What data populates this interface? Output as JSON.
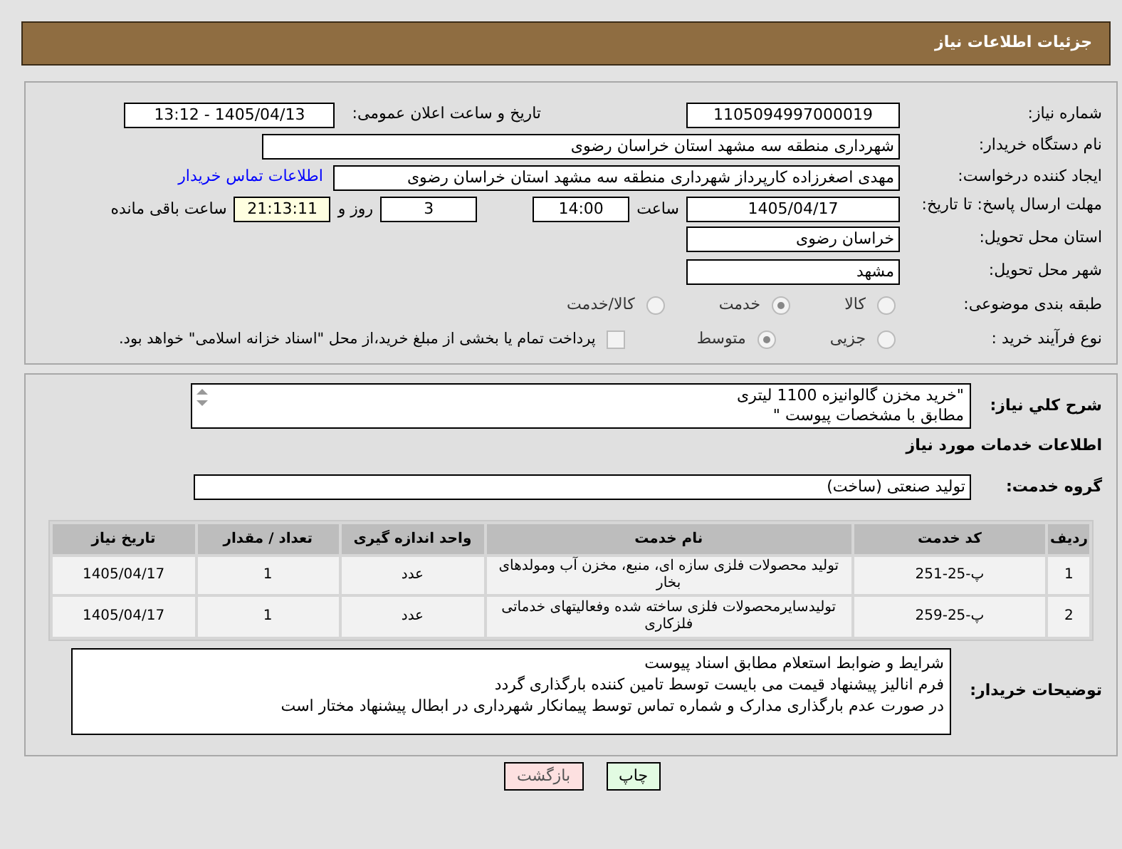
{
  "header": {
    "title": "جزئیات اطلاعات نیاز"
  },
  "need_number": {
    "label": "شماره نیاز:",
    "value": "1105094997000019"
  },
  "announce": {
    "label": "تاریخ و ساعت اعلان عمومی:",
    "value": "1405/04/13 - 13:12"
  },
  "buyer": {
    "label": "نام دستگاه خریدار:",
    "value": "شهرداری منطقه سه مشهد استان خراسان رضوی"
  },
  "creator": {
    "label": "ایجاد کننده درخواست:",
    "value": "مهدی اصغرزاده کارپرداز شهرداری منطقه سه مشهد استان خراسان رضوی",
    "link": "اطلاعات تماس خریدار"
  },
  "deadline": {
    "label": "مهلت ارسال پاسخ: تا تاریخ:",
    "date": "1405/04/17",
    "time_label": "ساعت",
    "time": "14:00",
    "days": "3",
    "days_label": "روز و",
    "remaining": "21:13:11",
    "remaining_label": "ساعت باقی مانده"
  },
  "province": {
    "label": "استان محل تحویل:",
    "value": "خراسان رضوی"
  },
  "city": {
    "label": "شهر محل تحویل:",
    "value": "مشهد"
  },
  "category": {
    "label": "طبقه بندی موضوعی:",
    "options": [
      {
        "label": "کالا",
        "selected": false
      },
      {
        "label": "خدمت",
        "selected": true
      },
      {
        "label": "کالا/خدمت",
        "selected": false
      }
    ]
  },
  "process": {
    "label": "نوع فرآیند خرید :",
    "options": [
      {
        "label": "جزیی",
        "selected": false
      },
      {
        "label": "متوسط",
        "selected": true
      }
    ],
    "payment": {
      "checked": false,
      "text": "پرداخت تمام یا بخشی از مبلغ خرید،از محل \"اسناد خزانه اسلامی\" خواهد بود."
    }
  },
  "description": {
    "label": "شرح كلي نياز:",
    "lines": [
      "\"خرید مخزن گالوانیزه 1100 لیتری",
      "مطابق با مشخصات پیوست \""
    ]
  },
  "services_title": "اطلاعات خدمات مورد نیاز",
  "service_group": {
    "label": "گروه خدمت:",
    "value": "تولید صنعتی (ساخت)"
  },
  "table": {
    "columns": [
      "ردیف",
      "کد خدمت",
      "نام خدمت",
      "واحد اندازه گیری",
      "تعداد / مقدار",
      "تاریخ نیاز"
    ],
    "rows": [
      [
        "1",
        "پ-25-251",
        "تولید محصولات فلزی سازه ای، منبع، مخزن آب ومولدهای بخار",
        "عدد",
        "1",
        "1405/04/17"
      ],
      [
        "2",
        "پ-25-259",
        "تولیدسایرمحصولات فلزی ساخته شده وفعالیتهای خدماتی فلزکاری",
        "عدد",
        "1",
        "1405/04/17"
      ]
    ]
  },
  "buyer_notes": {
    "label": "توضیحات خریدار:",
    "lines": [
      "شرایط و ضوابط استعلام مطابق اسناد پیوست",
      "فرم انالیز پیشنهاد قیمت می بایست توسط تامین کننده بارگذاری گردد",
      "در صورت عدم بارگذاری مدارک و شماره تماس توسط پیمانکار شهرداری در ابطال پیشنهاد مختار است"
    ]
  },
  "buttons": [
    {
      "label": "چاپ",
      "kind": "print"
    },
    {
      "label": "بازگشت",
      "kind": "back"
    }
  ]
}
